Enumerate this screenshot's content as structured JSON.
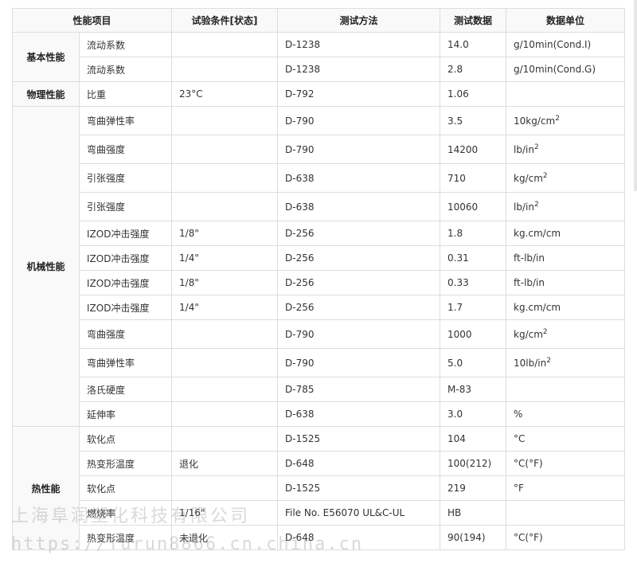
{
  "headers": [
    "性能项目",
    "试验条件[状态]",
    "测试方法",
    "测试数据",
    "数据单位"
  ],
  "groups": {
    "basic": "基本性能",
    "physical": "物理性能",
    "mechanical": "机械性能",
    "thermal": "热性能"
  },
  "rows": [
    {
      "item": "流动系数",
      "cond": "",
      "method": "D-1238",
      "value": "14.0",
      "unit": "g/10min(Cond.I)",
      "sup": ""
    },
    {
      "item": "流动系数",
      "cond": "",
      "method": "D-1238",
      "value": "2.8",
      "unit": "g/10min(Cond.G)",
      "sup": ""
    },
    {
      "item": "比重",
      "cond": "23°C",
      "method": "D-792",
      "value": "1.06",
      "unit": "",
      "sup": ""
    },
    {
      "item": "弯曲弹性率",
      "cond": "",
      "method": "D-790",
      "value": "3.5",
      "unit": "10kg/cm",
      "sup": "2"
    },
    {
      "item": "弯曲强度",
      "cond": "",
      "method": "D-790",
      "value": "14200",
      "unit": "lb/in",
      "sup": "2"
    },
    {
      "item": "引张强度",
      "cond": "",
      "method": "D-638",
      "value": "710",
      "unit": "kg/cm",
      "sup": "2"
    },
    {
      "item": "引张强度",
      "cond": "",
      "method": "D-638",
      "value": "10060",
      "unit": "lb/in",
      "sup": "2"
    },
    {
      "item": "IZOD冲击强度",
      "cond": "1/8\"",
      "method": "D-256",
      "value": "1.8",
      "unit": "kg.cm/cm",
      "sup": ""
    },
    {
      "item": "IZOD冲击强度",
      "cond": "1/4\"",
      "method": "D-256",
      "value": "0.31",
      "unit": "ft-lb/in",
      "sup": ""
    },
    {
      "item": "IZOD冲击强度",
      "cond": "1/8\"",
      "method": "D-256",
      "value": "0.33",
      "unit": "ft-lb/in",
      "sup": ""
    },
    {
      "item": "IZOD冲击强度",
      "cond": "1/4\"",
      "method": "D-256",
      "value": "1.7",
      "unit": "kg.cm/cm",
      "sup": ""
    },
    {
      "item": "弯曲强度",
      "cond": "",
      "method": "D-790",
      "value": "1000",
      "unit": "kg/cm",
      "sup": "2"
    },
    {
      "item": "弯曲弹性率",
      "cond": "",
      "method": "D-790",
      "value": "5.0",
      "unit": "10lb/in",
      "sup": "2"
    },
    {
      "item": "洛氏硬度",
      "cond": "",
      "method": "D-785",
      "value": "M-83",
      "unit": "",
      "sup": ""
    },
    {
      "item": "延伸率",
      "cond": "",
      "method": "D-638",
      "value": "3.0",
      "unit": "%",
      "sup": ""
    },
    {
      "item": "软化点",
      "cond": "",
      "method": "D-1525",
      "value": "104",
      "unit": "°C",
      "sup": ""
    },
    {
      "item": "热变形温度",
      "cond": "退化",
      "method": "D-648",
      "value": "100(212)",
      "unit": "°C(°F)",
      "sup": ""
    },
    {
      "item": "软化点",
      "cond": "",
      "method": "D-1525",
      "value": "219",
      "unit": "°F",
      "sup": ""
    },
    {
      "item": "燃烧率",
      "cond": "1/16\"",
      "method": "File No. E56070 UL&C-UL",
      "value": "HB",
      "unit": "",
      "sup": ""
    },
    {
      "item": "热变形温度",
      "cond": "未退化",
      "method": "D-648",
      "value": "90(194)",
      "unit": "°C(°F)",
      "sup": ""
    }
  ],
  "watermark": {
    "line1": "上海阜润塑化科技有限公司",
    "line2": "https://furun8866.cn.china.cn"
  }
}
